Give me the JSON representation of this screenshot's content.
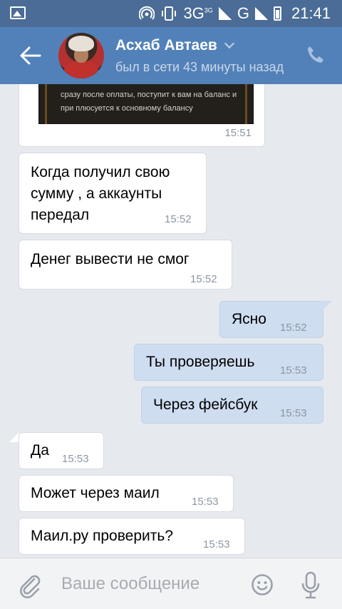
{
  "status_bar": {
    "network": "3G",
    "network_sup": "3G",
    "network2": "G",
    "time": "21:41"
  },
  "header": {
    "name": "Асхаб Автаев",
    "status": "был в сети 43 минуты назад"
  },
  "image_message": {
    "text": "сразу после оплаты, поступит к вам на баланс и при плюсуется к основному балансу",
    "time": "15:51"
  },
  "messages": [
    {
      "direction": "in",
      "text": "Когда получил свою сумму , а аккаунты передал",
      "time": "15:52"
    },
    {
      "direction": "in",
      "text": "Денег вывести не смог",
      "time": "15:52"
    },
    {
      "direction": "out",
      "text": "Ясно",
      "time": "15:52"
    },
    {
      "direction": "out",
      "text": "Ты проверяешь",
      "time": "15:53"
    },
    {
      "direction": "out",
      "text": "Через фейсбук",
      "time": "15:53"
    },
    {
      "direction": "in",
      "text": "Да",
      "time": "15:53"
    },
    {
      "direction": "in",
      "text": "Может через маил",
      "time": "15:53"
    },
    {
      "direction": "in",
      "text": "Маил.ру проверить?",
      "time": "15:53"
    }
  ],
  "input": {
    "placeholder": "Ваше сообщение"
  },
  "colors": {
    "header": "#5181b8",
    "status_bar": "#4a6c96",
    "incoming": "#ffffff",
    "outgoing": "#cfddf1",
    "background": "#e6e9ee"
  },
  "icons": [
    "gallery-icon",
    "hotspot-icon",
    "vibrate-icon",
    "signal-icon",
    "battery-icon",
    "back-arrow-icon",
    "chevron-down-icon",
    "phone-icon",
    "attach-icon",
    "emoji-icon",
    "microphone-icon"
  ]
}
